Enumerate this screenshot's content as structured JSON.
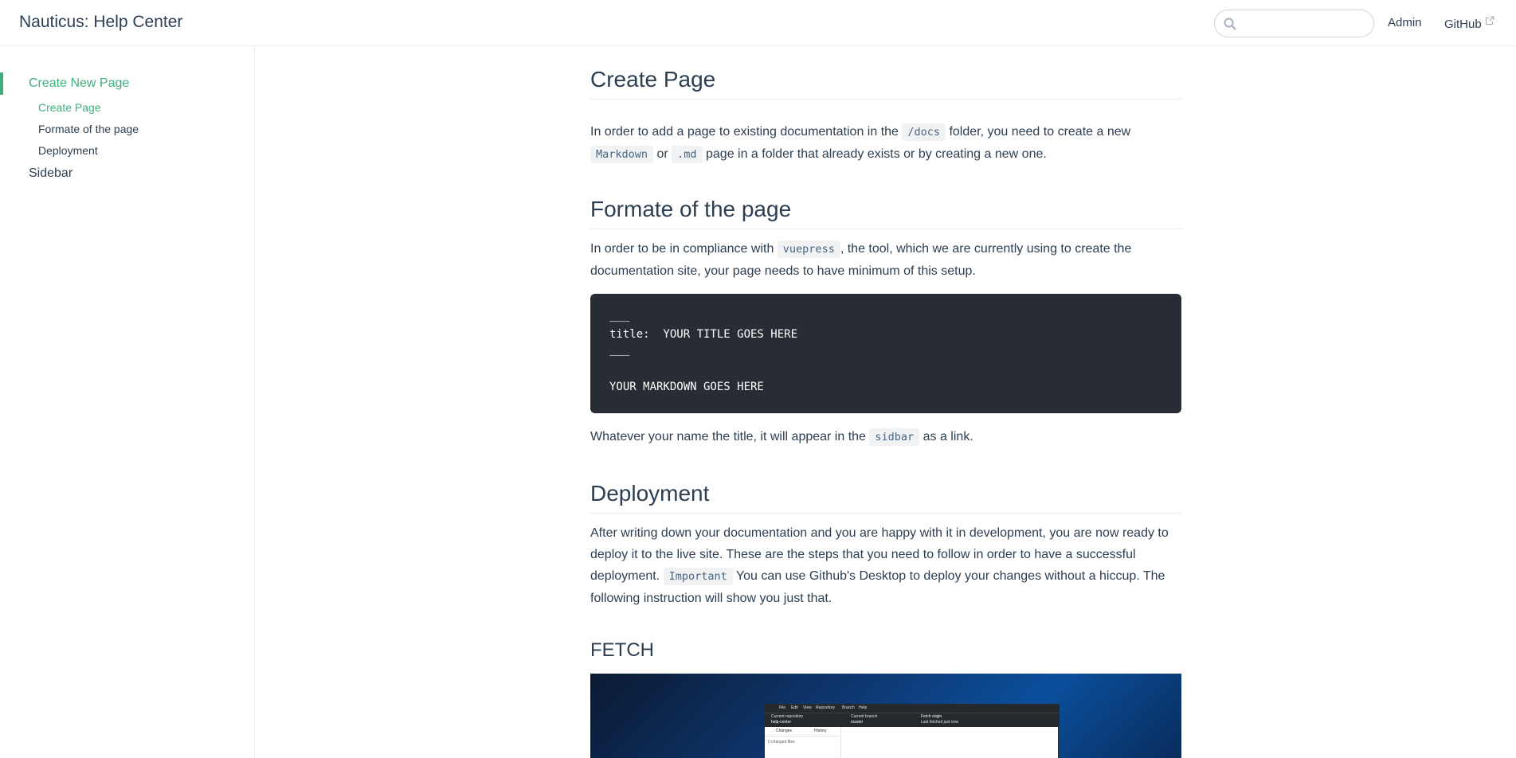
{
  "navbar": {
    "site_name": "Nauticus: Help Center",
    "search_placeholder": "",
    "links": [
      {
        "label": "Admin"
      },
      {
        "label": "GitHub",
        "external": true
      }
    ]
  },
  "sidebar": {
    "groups": [
      {
        "title": "Create New Page",
        "active": true,
        "children": [
          {
            "label": "Create Page",
            "active": true
          },
          {
            "label": "Formate of the page",
            "active": false
          },
          {
            "label": "Deployment",
            "active": false
          }
        ]
      },
      {
        "title": "Sidebar",
        "active": false
      }
    ]
  },
  "content": {
    "create_page": {
      "heading": "Create Page",
      "p1_a": "In order to add a page to existing documentation in the ",
      "p1_code1": "/docs",
      "p1_b": " folder, you need to create a new",
      "p1_code2": "Markdown",
      "p1_c": " or ",
      "p1_code3": ".md",
      "p1_d": " page in a folder that already exists or by creating a new one."
    },
    "format": {
      "heading": "Formate of the page",
      "p1_a": "In order to be in compliance with ",
      "p1_code": "vuepress",
      "p1_b": ", the tool, which we are currently using to create the",
      "p1_c": "documentation site, your page needs to have minimum of this setup.",
      "code_lines": [
        "___",
        "title:  YOUR TITLE GOES HERE",
        "___",
        "",
        "YOUR MARKDOWN GOES HERE"
      ],
      "p2_a": "Whatever your name the title, it will appear in the ",
      "p2_code": "sidbar",
      "p2_b": " as a link."
    },
    "deployment": {
      "heading": "Deployment",
      "line1": "After writing down your documentation and you are happy with it in development, you are now ready to",
      "line2": "deploy it to the live site. These are the steps that you need to follow in order to have a successful",
      "line3_a": "deployment. ",
      "line3_code": "Important",
      "line3_b": " You can use Github's Desktop to deploy your changes without a hiccup. The",
      "line4": "following instruction will show you just that."
    },
    "fetch": {
      "heading": "FETCH",
      "screenshot": {
        "menu": [
          "File",
          "Edit",
          "View",
          "Repository",
          "Branch",
          "Help"
        ],
        "repo_label": "Current repository",
        "repo_name": "help-center",
        "branch_label": "Current branch",
        "branch_name": "master",
        "fetch_label": "Fetch origin",
        "fetch_sub": "Last fetched just now",
        "tabs": [
          "Changes",
          "History"
        ],
        "row": "0 changed files"
      }
    }
  },
  "colors": {
    "accent": "#3eaf7c",
    "text": "#2c3e50",
    "code_bg": "#282c34",
    "inline_code_bg": "#f1f2f4"
  }
}
